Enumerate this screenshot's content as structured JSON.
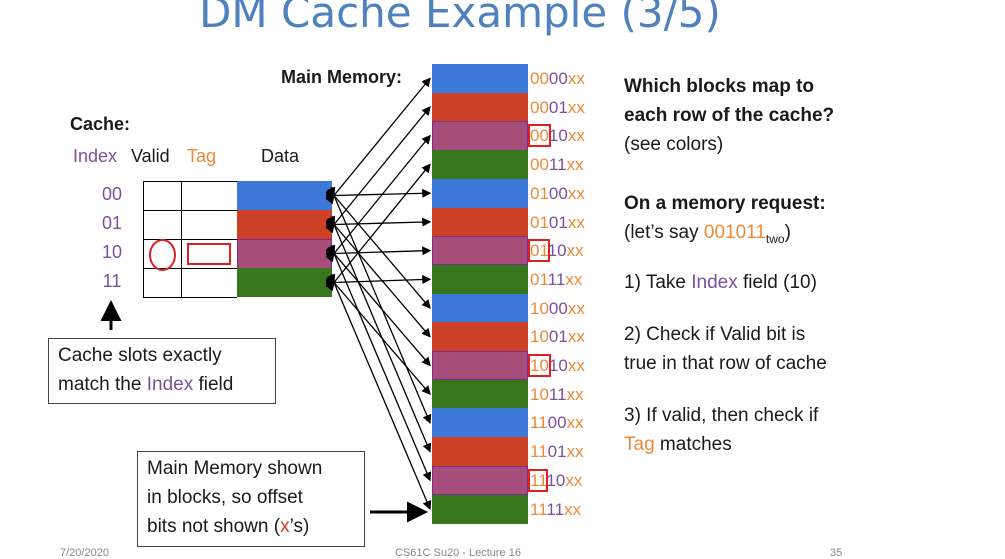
{
  "title": "DM Cache Example (3/5)",
  "main_memory_label": "Main Memory:",
  "cache": {
    "label": "Cache:",
    "headers": {
      "index": "Index",
      "valid": "Valid",
      "tag": "Tag",
      "data": "Data"
    },
    "rows": [
      "00",
      "01",
      "10",
      "11"
    ]
  },
  "memory": {
    "blocks": [
      {
        "prefix": "00",
        "index": "00",
        "suffix": "xx",
        "color": "#3c78d8"
      },
      {
        "prefix": "00",
        "index": "01",
        "suffix": "xx",
        "color": "#cc4125"
      },
      {
        "prefix": "00",
        "index": "10",
        "suffix": "xx",
        "color": "#a64d79"
      },
      {
        "prefix": "00",
        "index": "11",
        "suffix": "xx",
        "color": "#38761d"
      },
      {
        "prefix": "01",
        "index": "00",
        "suffix": "xx",
        "color": "#3c78d8"
      },
      {
        "prefix": "01",
        "index": "01",
        "suffix": "xx",
        "color": "#cc4125"
      },
      {
        "prefix": "01",
        "index": "10",
        "suffix": "xx",
        "color": "#a64d79"
      },
      {
        "prefix": "01",
        "index": "11",
        "suffix": "xx",
        "color": "#38761d"
      },
      {
        "prefix": "10",
        "index": "00",
        "suffix": "xx",
        "color": "#3c78d8"
      },
      {
        "prefix": "10",
        "index": "01",
        "suffix": "xx",
        "color": "#cc4125"
      },
      {
        "prefix": "10",
        "index": "10",
        "suffix": "xx",
        "color": "#a64d79"
      },
      {
        "prefix": "10",
        "index": "11",
        "suffix": "xx",
        "color": "#38761d"
      },
      {
        "prefix": "11",
        "index": "00",
        "suffix": "xx",
        "color": "#3c78d8"
      },
      {
        "prefix": "11",
        "index": "01",
        "suffix": "xx",
        "color": "#cc4125"
      },
      {
        "prefix": "11",
        "index": "10",
        "suffix": "xx",
        "color": "#a64d79"
      },
      {
        "prefix": "11",
        "index": "11",
        "suffix": "xx",
        "color": "#38761d"
      }
    ]
  },
  "cache_note": {
    "line1": "Cache slots exactly",
    "line2_pre": "match the ",
    "line2_index": "Index",
    "line2_post": " field"
  },
  "memory_note": {
    "line1": "Main Memory shown",
    "line2": "in blocks, so offset",
    "line3_pre": "bits not shown (",
    "line3_x": "x",
    "line3_post": "’s)"
  },
  "right": {
    "q1_line1": "Which blocks map to",
    "q1_line2": "each row of the cache?",
    "q1_line3": "(see colors)",
    "q2_line1": "On a memory request:",
    "q2_pre": "(let’s say ",
    "q2_addr": "001011",
    "q2_sub": "two",
    "q2_post": ")",
    "step1_pre": "1) Take ",
    "step1_index": "Index",
    "step1_post": " field (10)",
    "step2_line1": "2) Check if Valid bit is",
    "step2_line2": "true in that row of cache",
    "step3_line1": "3) If valid, then check if",
    "step3_tag": "Tag",
    "step3_post": " matches"
  },
  "footer": {
    "date": "7/20/2020",
    "course": "CS61C Su20 - Lecture 16",
    "page": "35"
  },
  "colors": {
    "blue": "#3c78d8",
    "red": "#cc4125",
    "purple": "#a64d79",
    "green": "#38761d",
    "index_text": "#7b4f9e",
    "tag_text": "#ed8a3a",
    "highlight": "#e02020"
  }
}
